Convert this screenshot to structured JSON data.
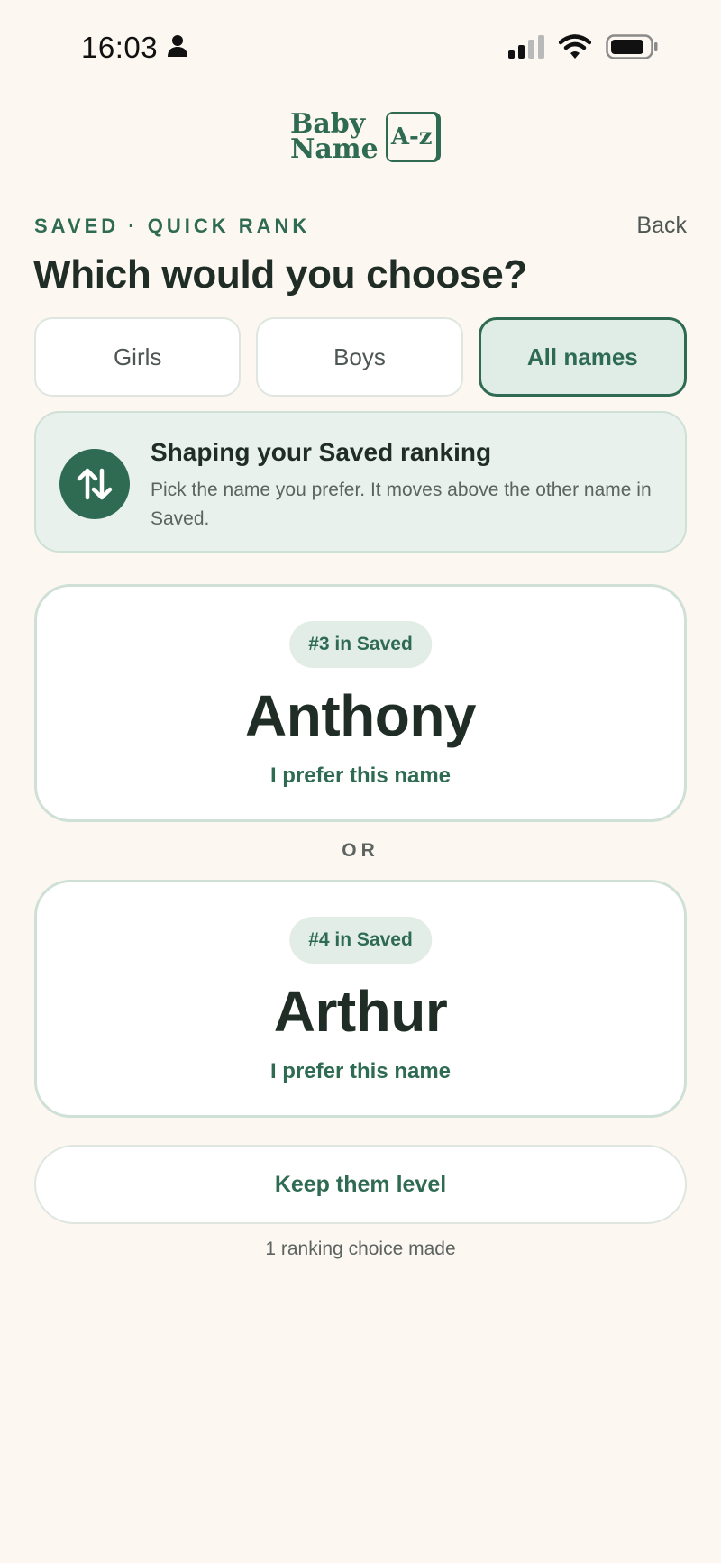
{
  "status_bar": {
    "time": "16:03",
    "icons": [
      "person-icon",
      "signal-icon",
      "wifi-icon",
      "battery-icon"
    ]
  },
  "logo": {
    "line1": "Baby",
    "line2": "Name",
    "badge": "A-z"
  },
  "header": {
    "eyebrow": "SAVED · QUICK RANK",
    "back_label": "Back",
    "title": "Which would you choose?"
  },
  "filter_tabs": [
    {
      "label": "Girls",
      "active": false
    },
    {
      "label": "Boys",
      "active": false
    },
    {
      "label": "All names",
      "active": true
    }
  ],
  "info_card": {
    "icon": "swap-vertical-icon",
    "title": "Shaping your Saved ranking",
    "description": "Pick the name you prefer. It moves above the other name in Saved."
  },
  "choices": [
    {
      "rank_label": "#3 in Saved",
      "name": "Anthony",
      "action_label": "I prefer this name"
    },
    {
      "rank_label": "#4 in Saved",
      "name": "Arthur",
      "action_label": "I prefer this name"
    }
  ],
  "or_label": "OR",
  "level_button_label": "Keep them level",
  "choices_count_text": "1 ranking choice made",
  "colors": {
    "background": "#fdf7f1",
    "accent": "#2f6b52",
    "accent_light": "#dfede6",
    "text_dark": "#1f2d26",
    "text_muted": "#5c6360"
  }
}
